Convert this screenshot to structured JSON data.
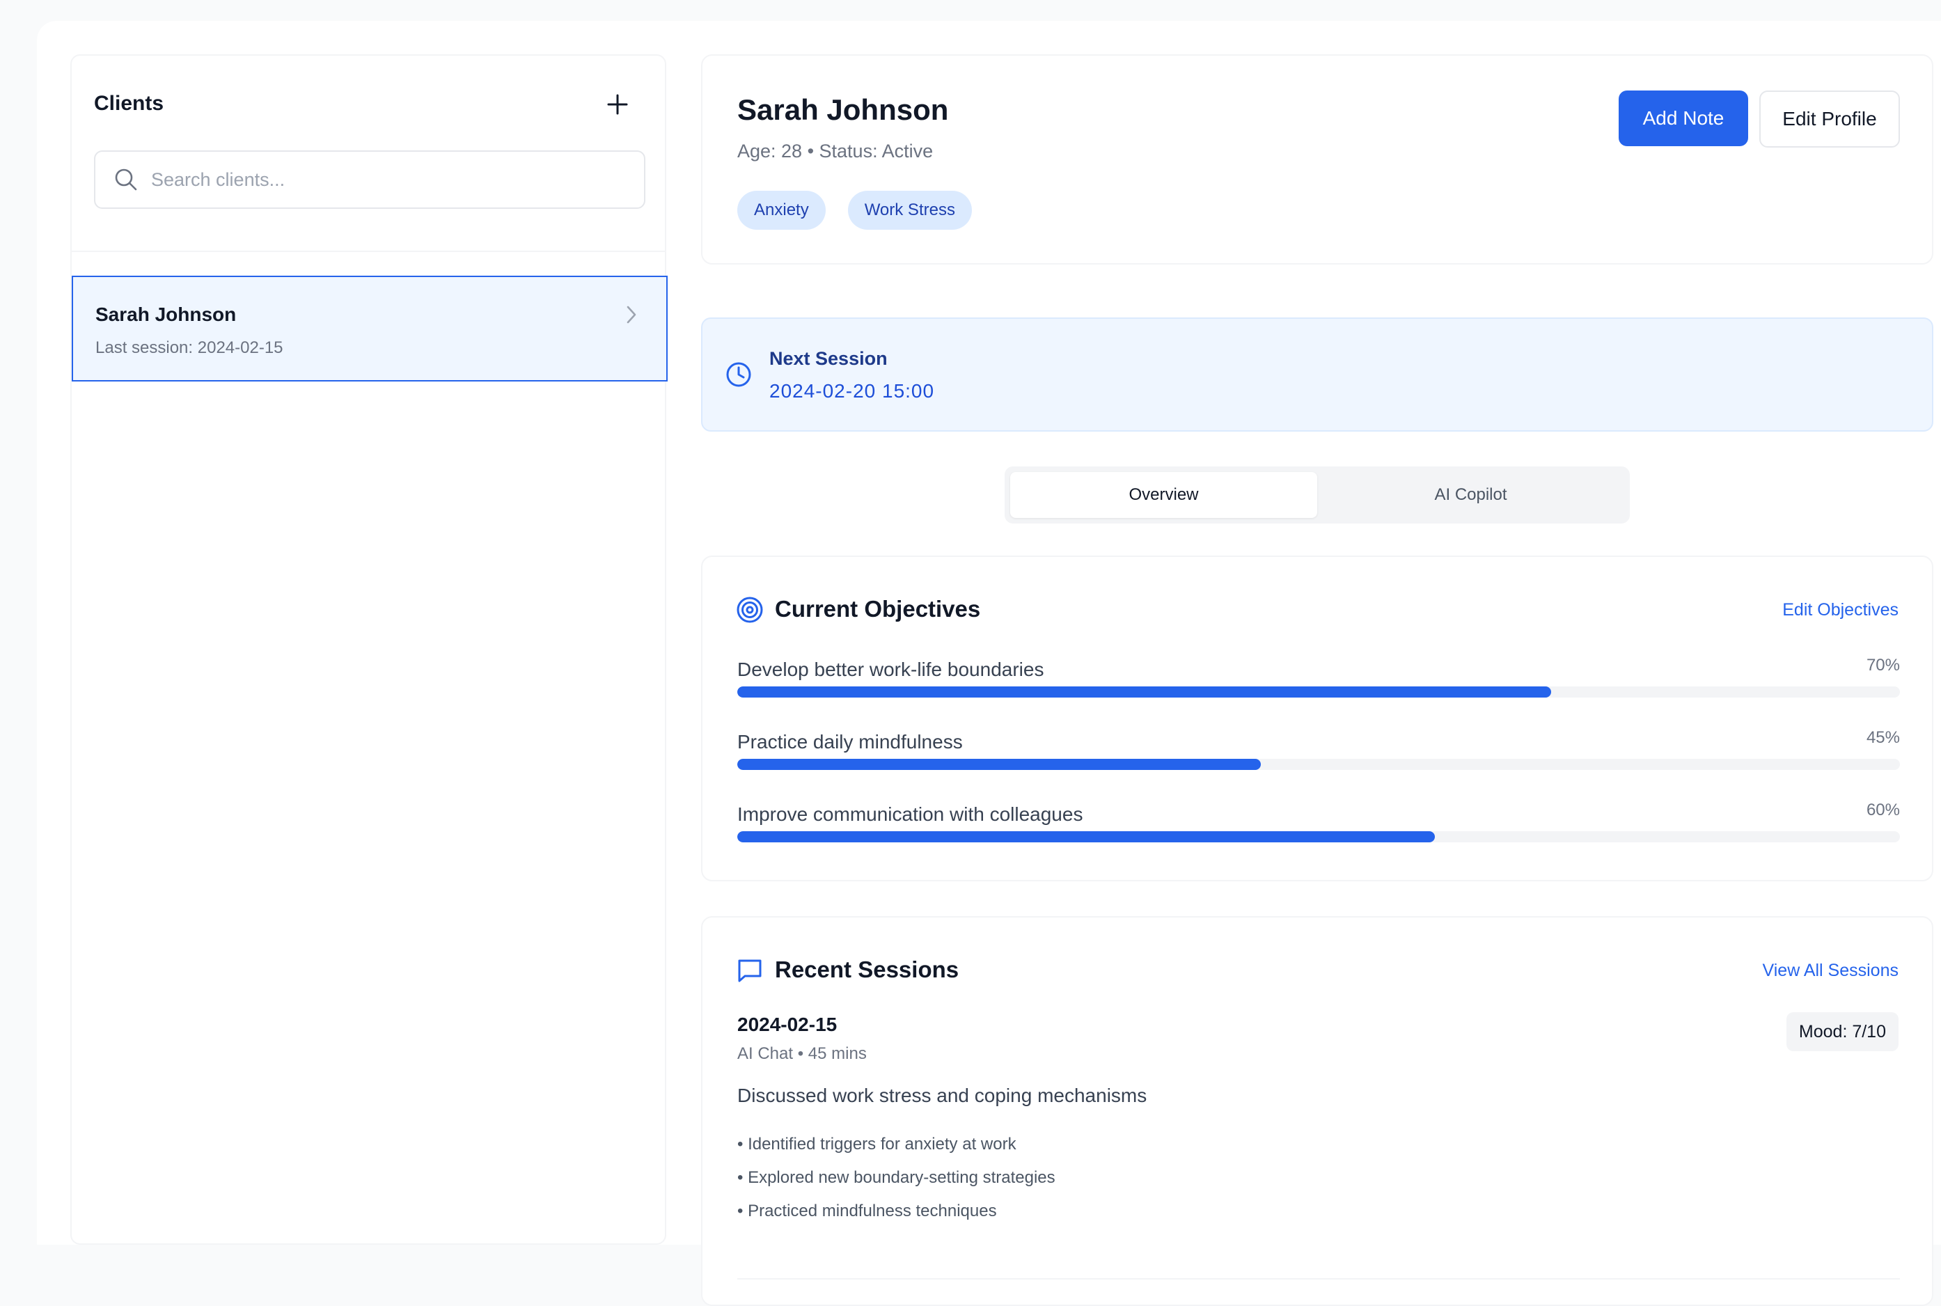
{
  "sidebar": {
    "title": "Clients",
    "search": {
      "placeholder": "Search clients...",
      "value": ""
    },
    "clients": [
      {
        "name": "Sarah Johnson",
        "last_session": "Last session: 2024-02-15"
      }
    ]
  },
  "profile": {
    "name": "Sarah Johnson",
    "meta": "Age: 28 • Status: Active",
    "tags": [
      "Anxiety",
      "Work Stress"
    ],
    "add_note_label": "Add Note",
    "edit_profile_label": "Edit Profile"
  },
  "next_session": {
    "label": "Next Session",
    "datetime": "2024-02-20 15:00"
  },
  "tabs": [
    {
      "label": "Overview",
      "active": true
    },
    {
      "label": "AI Copilot",
      "active": false
    }
  ],
  "objectives": {
    "title": "Current Objectives",
    "edit_label": "Edit Objectives",
    "items": [
      {
        "label": "Develop better work-life boundaries",
        "progress": 70,
        "progress_text": "70%"
      },
      {
        "label": "Practice daily mindfulness",
        "progress": 45,
        "progress_text": "45%"
      },
      {
        "label": "Improve communication with colleagues",
        "progress": 60,
        "progress_text": "60%"
      }
    ]
  },
  "sessions": {
    "title": "Recent Sessions",
    "view_all_label": "View All Sessions",
    "items": [
      {
        "date": "2024-02-15",
        "meta": "AI Chat • 45 mins",
        "mood": "Mood: 7/10",
        "summary": "Discussed work stress and coping mechanisms",
        "notes": [
          "• Identified triggers for anxiety at work",
          "• Explored new boundary-setting strategies",
          "• Practiced mindfulness techniques"
        ]
      }
    ]
  },
  "colors": {
    "accent": "#2563eb",
    "accent_light": "#eff6ff",
    "tag_bg": "#dbeafe"
  },
  "icons": {
    "add": "plus-icon",
    "search": "search-icon",
    "chevron": "chevron-right-icon",
    "clock": "clock-icon",
    "target": "target-icon",
    "chat": "chat-bubble-icon"
  }
}
